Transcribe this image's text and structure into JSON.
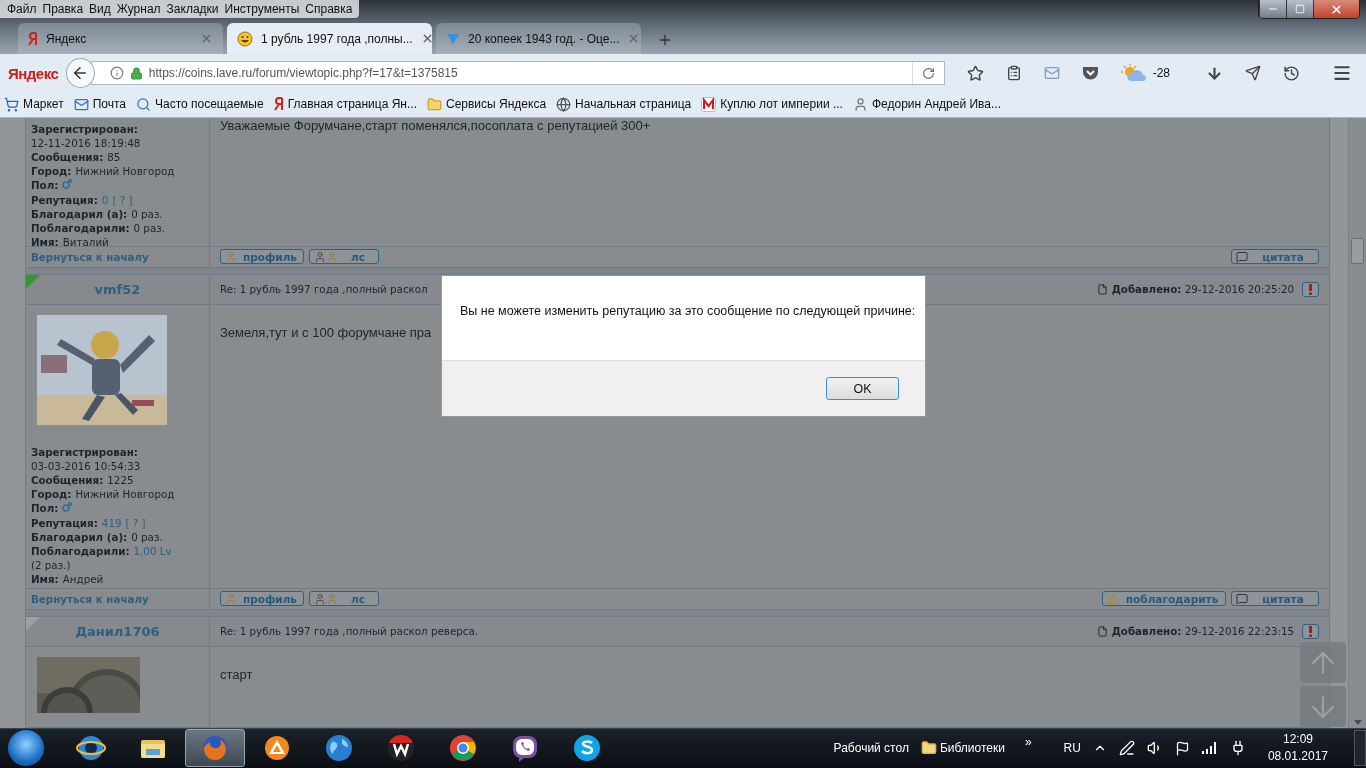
{
  "menu": [
    "Файл",
    "Правка",
    "Вид",
    "Журнал",
    "Закладки",
    "Инструменты",
    "Справка"
  ],
  "tabs": [
    {
      "label": "Яндекс",
      "kind": "yandex",
      "selected": false
    },
    {
      "label": "1 рубль 1997 года ,полны...",
      "kind": "smiley",
      "selected": true
    },
    {
      "label": "20 копеек 1943 год. - Оце...",
      "kind": "coin",
      "selected": false
    }
  ],
  "logo": "Яндекс",
  "url": "https://coins.lave.ru/forum/viewtopic.php?f=17&t=1375815",
  "weather": "-28",
  "bookmarks": [
    {
      "label": "Маркет",
      "kind": "cart"
    },
    {
      "label": "Почта",
      "kind": "mail"
    },
    {
      "label": "Часто посещаемые",
      "kind": "search"
    },
    {
      "label": "Главная страница Ян...",
      "kind": "yandex"
    },
    {
      "label": "Сервисы Яндекса",
      "kind": "folder"
    },
    {
      "label": "Начальная страница",
      "kind": "globe"
    },
    {
      "label": "Куплю лот империи ...",
      "kind": "m"
    },
    {
      "label": "Федорин Андрей Ива...",
      "kind": "person"
    }
  ],
  "posts": [
    {
      "body": "Уважаемые Форумчане,старт поменялся,посоплата с репутацией 300+",
      "fields": [
        {
          "kind": "text",
          "label": "Зарегистрирован:",
          "parts": [
            {
              "text": "12-11-2016 18:19:48",
              "link": false
            }
          ]
        },
        {
          "kind": "text",
          "label": "Сообщения:",
          "parts": [
            {
              "text": "85",
              "link": false
            }
          ]
        },
        {
          "kind": "text",
          "label": "Город:",
          "parts": [
            {
              "text": "Нижний Новгород",
              "link": false
            }
          ]
        },
        {
          "kind": "gender",
          "label": "Пол:"
        },
        {
          "kind": "text",
          "label": "Репутация:",
          "parts": [
            {
              "text": "0",
              "link": true
            },
            {
              "text": "[ ? ]",
              "link": true
            }
          ]
        },
        {
          "kind": "text",
          "label": "Благодарил (а):",
          "parts": [
            {
              "text": "0 раз.",
              "link": false
            }
          ]
        },
        {
          "kind": "text",
          "label": "Поблагодарили:",
          "parts": [
            {
              "text": "0 раз.",
              "link": false
            }
          ]
        },
        {
          "kind": "text",
          "label": "Имя:",
          "parts": [
            {
              "text": "Виталий",
              "link": false
            }
          ]
        }
      ],
      "footer": {
        "back": "Вернуться к началу",
        "buttons": [
          {
            "label": "профиль",
            "kind": "profile"
          },
          {
            "label": "лс",
            "kind": "pm"
          },
          {
            "label": "цитата",
            "kind": "quote"
          }
        ]
      }
    },
    {
      "header": {
        "author": "vmf52",
        "online": true,
        "subject": "Re: 1 рубль 1997 года ,полный раскол",
        "added": "**Добавлено:** 29-12-2016 20:25:20"
      },
      "avatar": {
        "kind": "picture"
      },
      "body": "Земеля,тут и с 100 форумчане пра",
      "fields": [
        {
          "kind": "text",
          "label": "Зарегистрирован:",
          "parts": [
            {
              "text": "03-03-2016 10:54:33",
              "link": false
            }
          ]
        },
        {
          "kind": "text",
          "label": "Сообщения:",
          "parts": [
            {
              "text": "1225",
              "link": false
            }
          ]
        },
        {
          "kind": "text",
          "label": "Город:",
          "parts": [
            {
              "text": "Нижний Новгород",
              "link": false
            }
          ]
        },
        {
          "kind": "gender",
          "label": "Пол:"
        },
        {
          "kind": "text",
          "label": "Репутация:",
          "parts": [
            {
              "text": "419",
              "link": true
            },
            {
              "text": "[ ? ]",
              "link": true
            }
          ]
        },
        {
          "kind": "text",
          "label": "Благодарил (а):",
          "parts": [
            {
              "text": "0 раз.",
              "link": false
            }
          ]
        },
        {
          "kind": "text",
          "label": "Поблагодарили:",
          "parts": [
            {
              "text": "1,00 Lv",
              "link": true
            },
            {
              "text": "(2 раз.)",
              "link": false
            }
          ]
        },
        {
          "kind": "text",
          "label": "Имя:",
          "parts": [
            {
              "text": "Андрей",
              "link": false
            }
          ]
        }
      ],
      "footer": {
        "back": "Вернуться к началу",
        "buttons": [
          {
            "label": "профиль",
            "kind": "profile"
          },
          {
            "label": "лс",
            "kind": "pm"
          },
          {
            "label": "поблагодарить",
            "kind": "thanks"
          },
          {
            "label": "цитата",
            "kind": "quote"
          }
        ]
      }
    },
    {
      "header": {
        "author": "Данил1706",
        "online": false,
        "subject": "Re: 1 рубль 1997 года ,полный раскол реверса.",
        "added": "**Добавлено:** 29-12-2016 22:23:15"
      },
      "avatar": {
        "kind": "picture"
      },
      "body": "старт"
    }
  ],
  "dialog": {
    "message": "Вы не можете изменить репутацию за это сообщение по следующей причине:",
    "button": "OK"
  },
  "taskbar": {
    "apps": [
      {
        "kind": "ie",
        "selected": false
      },
      {
        "kind": "explorer",
        "selected": false
      },
      {
        "kind": "firefox",
        "selected": true
      },
      {
        "kind": "avast",
        "selected": false
      },
      {
        "kind": "globe",
        "selected": false
      },
      {
        "kind": "wps",
        "selected": false
      },
      {
        "kind": "chrome",
        "selected": false
      },
      {
        "kind": "viber",
        "selected": false
      },
      {
        "kind": "skype",
        "selected": false
      }
    ],
    "desktop": "Рабочий стол",
    "libraries": "Библиотеки",
    "chevron": "»",
    "language": "RU",
    "time": "12:09",
    "date": "08.01.2017"
  }
}
